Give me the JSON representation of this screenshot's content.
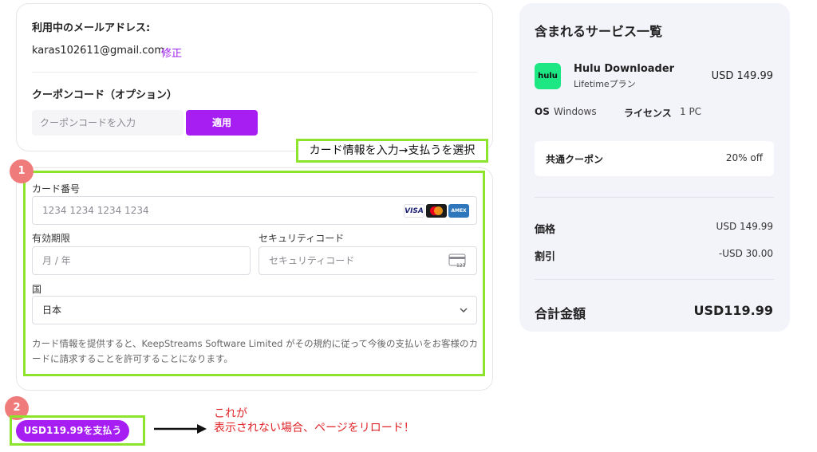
{
  "account": {
    "email_label": "利用中のメールアドレス:",
    "email": "karas102611@gmail.com",
    "edit_label": "修正"
  },
  "coupon": {
    "label": "クーポンコード（オプション）",
    "placeholder": "クーポンコードを入力",
    "apply_label": "適用"
  },
  "annotations": {
    "step1_badge": "1",
    "step2_badge": "2",
    "callout": "カード情報を入力→支払うを選択",
    "note_line1": "これが",
    "note_line2": "表示されない場合、ページをリロード！"
  },
  "payment": {
    "card_number_label": "カード番号",
    "card_number_placeholder": "1234 1234 1234 1234",
    "brands": {
      "visa": "VISA",
      "amex": "AMEX"
    },
    "expiry_label": "有効期限",
    "expiry_placeholder": "月 / 年",
    "cvc_label": "セキュリティコード",
    "cvc_placeholder": "セキュリティコード",
    "cvc_icon_text": "123",
    "country_label": "国",
    "country_value": "日本",
    "legal_text": "カード情報を提供すると、KeepStreams Software Limited がその規約に従って今後の支払いをお客様のカードに請求することを許可することになります。",
    "pay_button_label": "USD119.99を支払う"
  },
  "summary": {
    "title": "含まれるサービス一覧",
    "logo_text": "hulu",
    "product_name": "Hulu Downloader",
    "product_plan": "Lifetimeプラン",
    "product_price": "USD 149.99",
    "os_label": "OS",
    "os_value": "Windows",
    "license_label": "ライセンス",
    "license_value": "1 PC",
    "coupon_label": "共通クーポン",
    "coupon_value": "20% off",
    "price_label": "価格",
    "price_value": "USD 149.99",
    "discount_label": "割引",
    "discount_value": "-USD 30.00",
    "total_label": "合計金額",
    "total_value": "USD119.99"
  },
  "colors": {
    "accent": "#a61ef2",
    "highlight": "#8ee32c",
    "badge": "#f07b7b",
    "note": "#e0262a",
    "hulu": "#1ce783"
  }
}
